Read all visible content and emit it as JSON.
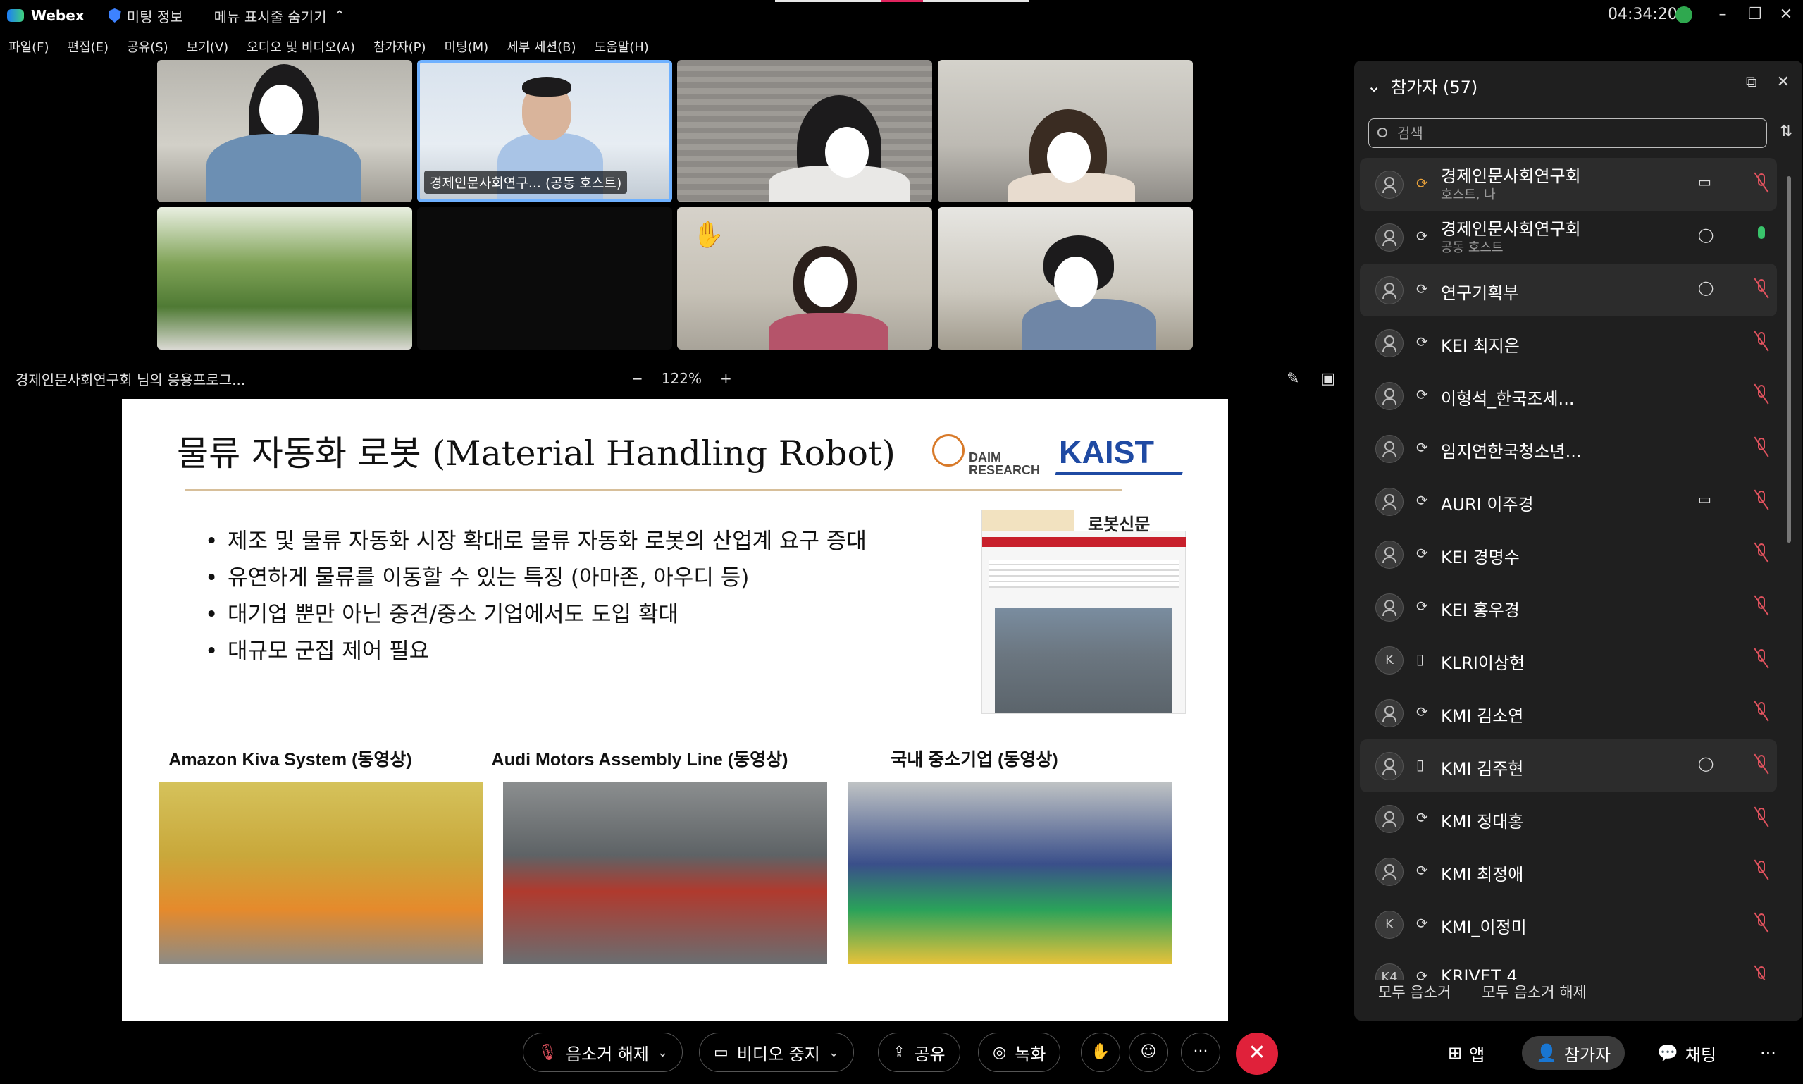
{
  "titlebar": {
    "app_name": "Webex",
    "meeting_info": "미팅 정보",
    "hide_menu": "메뉴 표시줄 숨기기",
    "clock": "04:34:20"
  },
  "menu": [
    "파일(F)",
    "편집(E)",
    "공유(S)",
    "보기(V)",
    "오디오 및 비디오(A)",
    "참가자(P)",
    "미팅(M)",
    "세부 세션(B)",
    "도움말(H)"
  ],
  "video_tiles": {
    "host_label": "경제인문사회연구... (공동 호스트)"
  },
  "share": {
    "sharer_label": "경제인문사회연구회 님의 응용프로그...",
    "zoom_minus": "−",
    "zoom_level": "122%",
    "zoom_plus": "+"
  },
  "slide": {
    "title": "물류 자동화 로봇 (Material Handling Robot)",
    "daim_logo": "DAIM RESEARCH",
    "kaist_logo": "KAIST",
    "newspaper_logo": "로봇신문",
    "bullets": [
      "제조 및 물류 자동화 시장 확대로 물류 자동화 로봇의 산업계 요구 증대",
      "유연하게 물류를 이동할 수 있는 특징 (아마존, 아우디 등)",
      "대기업 뿐만 아닌 중견/중소 기업에서도 도입 확대",
      "대규모 군집 제어 필요"
    ],
    "captions": [
      "Amazon Kiva System (동영상)",
      "Audi Motors Assembly Line (동영상)",
      "국내 중소기업 (동영상)"
    ]
  },
  "participants": {
    "header": "참가자 (57)",
    "search_placeholder": "검색",
    "list": [
      {
        "avatar": "",
        "device": "headset",
        "name": "경제인문사회연구회",
        "sub": "호스트, 나",
        "video": true,
        "chat": false,
        "muted": true,
        "hl": true
      },
      {
        "avatar": "",
        "device": "headset",
        "name": "경제인문사회연구회",
        "sub": "공동 호스트",
        "video": false,
        "chat": true,
        "muted": false,
        "hl": false
      },
      {
        "avatar": "",
        "device": "headset",
        "name": "연구기획부",
        "sub": "",
        "video": false,
        "chat": true,
        "muted": true,
        "hl": true
      },
      {
        "avatar": "",
        "device": "headset",
        "name": "KEI 최지은",
        "sub": "",
        "video": false,
        "chat": false,
        "muted": true,
        "hl": false
      },
      {
        "avatar": "",
        "device": "headset",
        "name": "이형석_한국조세...",
        "sub": "",
        "video": false,
        "chat": false,
        "muted": true,
        "hl": false
      },
      {
        "avatar": "",
        "device": "headset",
        "name": "임지연한국청소년...",
        "sub": "",
        "video": false,
        "chat": false,
        "muted": true,
        "hl": false
      },
      {
        "avatar": "",
        "device": "headset",
        "name": "AURI 이주경",
        "sub": "",
        "video": true,
        "chat": false,
        "muted": true,
        "hl": false
      },
      {
        "avatar": "",
        "device": "headset",
        "name": "KEI 경명수",
        "sub": "",
        "video": false,
        "chat": false,
        "muted": true,
        "hl": false
      },
      {
        "avatar": "",
        "device": "headset",
        "name": "KEI 홍우경",
        "sub": "",
        "video": false,
        "chat": false,
        "muted": true,
        "hl": false
      },
      {
        "avatar": "K",
        "device": "phone",
        "name": "KLRI이상현",
        "sub": "",
        "video": false,
        "chat": false,
        "muted": true,
        "hl": false
      },
      {
        "avatar": "",
        "device": "headset",
        "name": "KMI 김소연",
        "sub": "",
        "video": false,
        "chat": false,
        "muted": true,
        "hl": false
      },
      {
        "avatar": "",
        "device": "phone",
        "name": "KMI 김주현",
        "sub": "",
        "video": false,
        "chat": true,
        "muted": true,
        "hl": true
      },
      {
        "avatar": "",
        "device": "headset",
        "name": "KMI 정대홍",
        "sub": "",
        "video": false,
        "chat": false,
        "muted": true,
        "hl": false
      },
      {
        "avatar": "",
        "device": "headset",
        "name": "KMI 최정애",
        "sub": "",
        "video": false,
        "chat": false,
        "muted": true,
        "hl": false
      },
      {
        "avatar": "K",
        "device": "headset",
        "name": "KMI_이정미",
        "sub": "",
        "video": false,
        "chat": false,
        "muted": true,
        "hl": false
      },
      {
        "avatar": "K4",
        "device": "headset",
        "name": "KRIVET 4",
        "sub": "",
        "video": false,
        "chat": false,
        "muted": true,
        "hl": false
      }
    ],
    "mute_all": "모두 음소거",
    "unmute_all": "모두 음소거 해제"
  },
  "toolbar": {
    "unmute": "음소거 해제",
    "stop_video": "비디오 중지",
    "share": "공유",
    "record": "녹화",
    "more": "···",
    "apps": "앱",
    "participants": "참가자",
    "chat": "채팅",
    "overflow": "···"
  },
  "colors": {
    "end_call": "#e0213a",
    "mute_red": "#e0525e",
    "unmuted_green": "#39c46b",
    "active_tile": "#6fb1ff",
    "kaist_blue": "#1f4aa3"
  }
}
